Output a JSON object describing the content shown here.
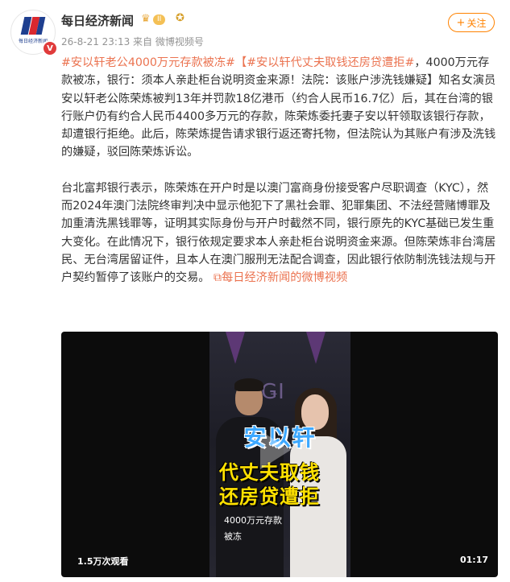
{
  "account": {
    "name": "每日经济新闻",
    "avatar_text": "每日经济新闻",
    "verified_badge": "V",
    "level_badge": "II",
    "meta": "26-8-21 23:13  来自 微博视频号"
  },
  "follow": {
    "label": "关注",
    "icon": "plus-icon"
  },
  "post": {
    "seg1_link": "#安以轩老公4000万元存款被冻#",
    "seg2_link": "【#安以轩代丈夫取钱还房贷遭拒#",
    "seg3": "，4000万元存款被冻，银行：须本人亲赴柜台说明资金来源！法院：该账户涉洗钱嫌疑】知名女演员安以轩老公陈荣炼被判13年并罚款18亿港币（约合人民币16.7亿）后，其在台湾的银行账户仍有约合人民币4400多万元的存款，陈荣炼委托妻子安以轩领取该银行存款，却遭银行拒绝。此后，陈荣炼提告请求银行返还寄托物，但法院认为其账户有涉及洗钱的嫌疑，驳回陈荣炼诉讼。",
    "para2": "台北富邦银行表示，陈荣炼在开户时是以澳门富商身份接受客户尽职调查（KYC），然而2024年澳门法院终审判决中显示他犯下了黑社会罪、犯罪集团、不法经营赌博罪及加重清洗黑钱罪等，证明其实际身份与开户时截然不同，银行原先的KYC基础已发生重大变化。在此情况下，银行依规定要求本人亲赴柜台说明资金来源。但陈荣炼非台湾居民、无台湾居留证件，且本人在澳门服刑无法配合调查，因此银行依防制洗钱法规与开户契约暂停了该账户的交易。",
    "video_link": "每日经济新闻的微博视频"
  },
  "video": {
    "title_line1": "安以轩",
    "title_line2": "代丈夫取钱",
    "title_line3": "还房贷遭拒",
    "subtitle_line1": "4000万元存款",
    "subtitle_line2": "被冻",
    "views": "1.5万次观看",
    "duration": "01:17"
  },
  "colors": {
    "link": "#eb7350",
    "follow": "#ff8200",
    "verified": "#e03b3b"
  }
}
